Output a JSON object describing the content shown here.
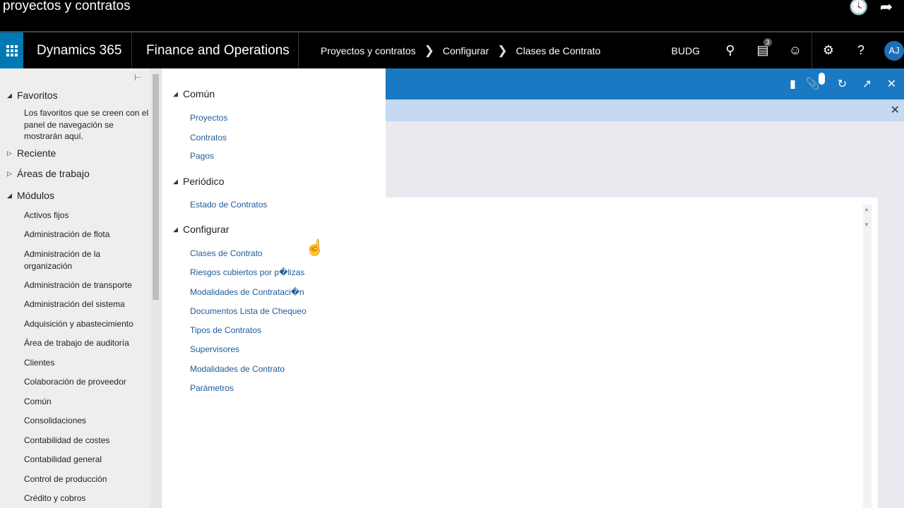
{
  "video": {
    "title": "proyectos y contratos",
    "icons": [
      "clock-icon",
      "share-icon"
    ]
  },
  "navbar": {
    "product": "Dynamics 365",
    "app": "Finance and Operations",
    "breadcrumbs": [
      "Proyectos y contratos",
      "Configurar",
      "Clases de Contrato"
    ],
    "company": "BUDG",
    "notifications_count": "3",
    "user_initials": "AJ"
  },
  "navpane": {
    "favorites": {
      "label": "Favoritos",
      "note": "Los favoritos que se creen con el panel de navegación se mostrarán aquí."
    },
    "recent": "Reciente",
    "workspaces": "Áreas de trabajo",
    "modules": {
      "label": "Módulos",
      "items": [
        "Activos fijos",
        "Administración de flota",
        "Administración de la organización",
        "Administración de transporte",
        "Administración del sistema",
        "Adquisición y abastecimiento",
        "Área de trabajo de auditoría",
        "Clientes",
        "Colaboración de proveedor",
        "Común",
        "Consolidaciones",
        "Contabilidad de costes",
        "Contabilidad general",
        "Control de producción",
        "Crédito y cobros"
      ]
    }
  },
  "flyout": {
    "sections": [
      {
        "label": "Común",
        "links": [
          "Proyectos",
          "Contratos",
          "Pagos"
        ]
      },
      {
        "label": "Periódico",
        "links": [
          "Estado de Contratos"
        ]
      },
      {
        "label": "Configurar",
        "links": [
          "Clases de Contrato",
          "Riesgos cubiertos por p�lizas",
          "Modalidades de Contrataci�n",
          "Documentos Lista de Chequeo",
          "Tipos de Contratos",
          "Supervisores",
          "Modalidades de Contrato",
          "Parámetros"
        ]
      }
    ]
  },
  "actionbar": {
    "attachments_count": "0"
  }
}
